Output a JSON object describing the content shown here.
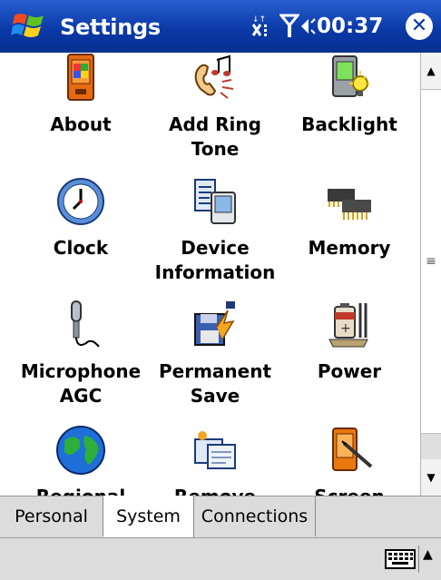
{
  "titlebar": {
    "title": "Settings",
    "time": "00:37",
    "close_glyph": "✕"
  },
  "icons_row": [
    [
      {
        "label_lines": [
          "About"
        ],
        "icon": "about-device-icon"
      },
      {
        "label_lines": [
          "Add Ring",
          "Tone"
        ],
        "icon": "ringtone-icon"
      },
      {
        "label_lines": [
          "Backlight"
        ],
        "icon": "backlight-icon"
      }
    ],
    [
      {
        "label_lines": [
          "Clock"
        ],
        "icon": "clock-icon"
      },
      {
        "label_lines": [
          "Device",
          "Information"
        ],
        "icon": "device-information-icon"
      },
      {
        "label_lines": [
          "Memory"
        ],
        "icon": "memory-chip-icon"
      }
    ],
    [
      {
        "label_lines": [
          "Microphone",
          "AGC"
        ],
        "icon": "microphone-icon"
      },
      {
        "label_lines": [
          "Permanent",
          "Save"
        ],
        "icon": "permanent-save-icon"
      },
      {
        "label_lines": [
          "Power"
        ],
        "icon": "battery-icon"
      }
    ],
    [
      {
        "label_lines": [
          "Regional"
        ],
        "icon": "globe-icon"
      },
      {
        "label_lines": [
          "Remove"
        ],
        "icon": "remove-programs-icon"
      },
      {
        "label_lines": [
          "Screen"
        ],
        "icon": "screen-stylus-icon"
      }
    ]
  ],
  "tabs": [
    {
      "label": "Personal",
      "active": false
    },
    {
      "label": "System",
      "active": true
    },
    {
      "label": "Connections",
      "active": false
    }
  ],
  "scrollbar": {
    "up_glyph": "▲",
    "down_glyph": "▼",
    "grip_glyph": "≡"
  },
  "menubar": {
    "sip_arrow": "▲"
  },
  "colors": {
    "titlebar": "#0a3aa8",
    "tab_bg": "#dcdcdc"
  }
}
